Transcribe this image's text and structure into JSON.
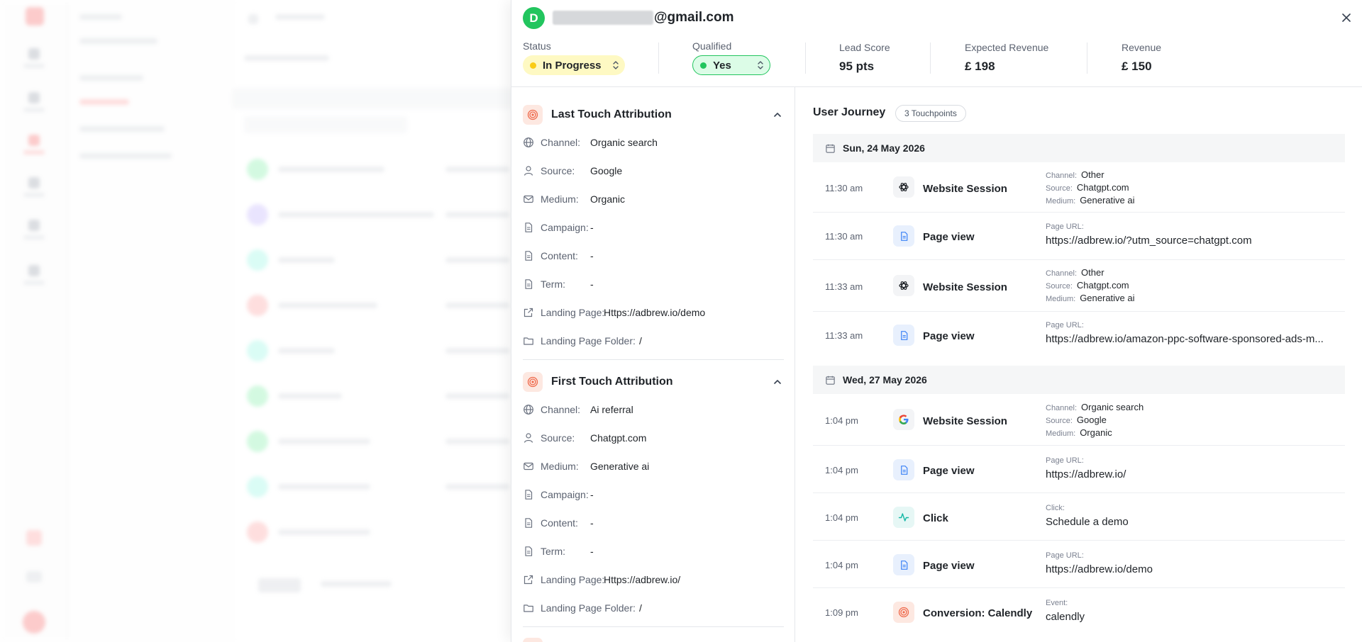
{
  "contact": {
    "avatar_initial": "D",
    "email_domain": "@gmail.com"
  },
  "header": {
    "status": {
      "label": "Status",
      "value": "In Progress",
      "dot_color": "#facc15"
    },
    "qualified": {
      "label": "Qualified",
      "value": "Yes",
      "dot_color": "#22c55e"
    },
    "lead_score": {
      "label": "Lead Score",
      "value": "95 pts"
    },
    "expected_revenue": {
      "label": "Expected Revenue",
      "value": "£ 198"
    },
    "revenue": {
      "label": "Revenue",
      "value": "£ 150"
    }
  },
  "last_touch": {
    "title": "Last Touch Attribution",
    "rows": [
      {
        "icon": "globe-icon",
        "label": "Channel:",
        "value": "Organic search"
      },
      {
        "icon": "user-icon",
        "label": "Source:",
        "value": "Google"
      },
      {
        "icon": "mail-icon",
        "label": "Medium:",
        "value": "Organic"
      },
      {
        "icon": "document-icon",
        "label": "Campaign:",
        "value": "-"
      },
      {
        "icon": "document-icon",
        "label": "Content:",
        "value": "-"
      },
      {
        "icon": "document-icon",
        "label": "Term:",
        "value": "-"
      },
      {
        "icon": "external-link-icon",
        "label": "Landing Page:",
        "value": "Https://adbrew.io/demo"
      },
      {
        "icon": "folder-icon",
        "label": "Landing Page Folder:",
        "value": "/"
      }
    ]
  },
  "first_touch": {
    "title": "First Touch Attribution",
    "rows": [
      {
        "icon": "globe-icon",
        "label": "Channel:",
        "value": "Ai referral"
      },
      {
        "icon": "user-icon",
        "label": "Source:",
        "value": "Chatgpt.com"
      },
      {
        "icon": "mail-icon",
        "label": "Medium:",
        "value": "Generative ai"
      },
      {
        "icon": "document-icon",
        "label": "Campaign:",
        "value": "-"
      },
      {
        "icon": "document-icon",
        "label": "Content:",
        "value": "-"
      },
      {
        "icon": "document-icon",
        "label": "Term:",
        "value": "-"
      },
      {
        "icon": "external-link-icon",
        "label": "Landing Page:",
        "value": "Https://adbrew.io/"
      },
      {
        "icon": "folder-icon",
        "label": "Landing Page Folder:",
        "value": "/"
      }
    ]
  },
  "journey": {
    "title": "User Journey",
    "touchpoints": "3 Touchpoints",
    "dates": [
      "Sun, 24 May 2026",
      "Wed, 27 May 2026"
    ],
    "events": [
      {
        "time": "11:30 am",
        "icon": "chatgpt-icon",
        "name": "Website Session",
        "details": {
          "channel_k": "Channel:",
          "channel": "Other",
          "source_k": "Source:",
          "source": "Chatgpt.com",
          "medium_k": "Medium:",
          "medium": "Generative ai"
        }
      },
      {
        "time": "11:30 am",
        "icon": "page-icon",
        "name": "Page view",
        "details": {
          "k": "Page URL:",
          "v": "https://adbrew.io/?utm_source=chatgpt.com"
        }
      },
      {
        "time": "11:33 am",
        "icon": "chatgpt-icon",
        "name": "Website Session",
        "details": {
          "channel_k": "Channel:",
          "channel": "Other",
          "source_k": "Source:",
          "source": "Chatgpt.com",
          "medium_k": "Medium:",
          "medium": "Generative ai"
        }
      },
      {
        "time": "11:33 am",
        "icon": "page-icon",
        "name": "Page view",
        "details": {
          "k": "Page URL:",
          "v": "https://adbrew.io/amazon-ppc-software-sponsored-ads-m..."
        }
      },
      {
        "time": "1:04 pm",
        "icon": "google-icon",
        "name": "Website Session",
        "details": {
          "channel_k": "Channel:",
          "channel": "Organic search",
          "source_k": "Source:",
          "source": "Google",
          "medium_k": "Medium:",
          "medium": "Organic"
        }
      },
      {
        "time": "1:04 pm",
        "icon": "page-icon",
        "name": "Page view",
        "details": {
          "k": "Page URL:",
          "v": "https://adbrew.io/"
        }
      },
      {
        "time": "1:04 pm",
        "icon": "activity-icon",
        "name": "Click",
        "details": {
          "k": "Click:",
          "v": "Schedule a demo"
        }
      },
      {
        "time": "1:04 pm",
        "icon": "page-icon",
        "name": "Page view",
        "details": {
          "k": "Page URL:",
          "v": "https://adbrew.io/demo"
        }
      },
      {
        "time": "1:09 pm",
        "icon": "target-icon",
        "name": "Conversion: Calendly",
        "details": {
          "k": "Event:",
          "v": "calendly"
        }
      }
    ]
  }
}
